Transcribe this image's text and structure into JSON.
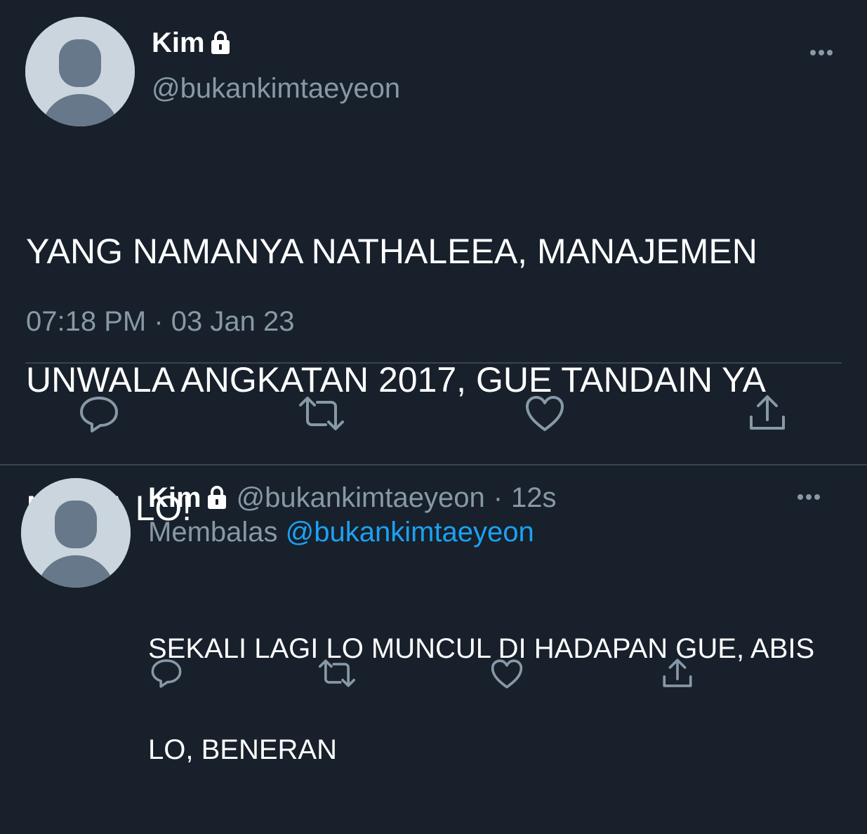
{
  "main_tweet": {
    "author_name": "Kim",
    "author_handle": "@bukankimtaeyeon",
    "text_lines": [
      "YANG NAMANYA NATHALEEA, MANAJEMEN",
      "UNWALA ANGKATAN 2017, GUE TANDAIN YA",
      "MUKA LO!"
    ],
    "timestamp": "07:18 PM · 03 Jan 23",
    "icons": {
      "more": "more-icon",
      "lock": "lock-icon",
      "reply": "reply-icon",
      "retweet": "retweet-icon",
      "like": "heart-icon",
      "share": "share-icon"
    }
  },
  "reply_tweet": {
    "author_name": "Kim",
    "author_handle": "@bukankimtaeyeon",
    "separator": "·",
    "age": "12s",
    "replying_label": "Membalas",
    "replying_to": "@bukankimtaeyeon",
    "text_lines": [
      "SEKALI LAGI LO MUNCUL DI HADAPAN GUE, ABIS",
      "LO, BENERAN"
    ]
  },
  "colors": {
    "background": "#17202b",
    "text": "#ffffff",
    "secondary": "#8899a6",
    "accent": "#1da1f2",
    "divider": "#38444d",
    "avatar_bg": "#cad5de",
    "avatar_fg": "#66788a"
  }
}
